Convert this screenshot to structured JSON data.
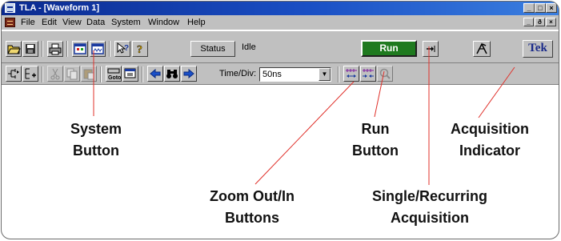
{
  "window": {
    "title": "TLA - [Waveform 1]",
    "minimize_glyph": "_",
    "maximize_glyph": "□",
    "close_glyph": "×",
    "restore_glyph": "ð",
    "doc_close_glyph": "×"
  },
  "menu": {
    "items": [
      {
        "label": "File"
      },
      {
        "label": "Edit"
      },
      {
        "label": "View"
      },
      {
        "label": "Data"
      },
      {
        "label": "System"
      },
      {
        "label": "Window"
      },
      {
        "label": "Help"
      }
    ]
  },
  "toolbar1": {
    "status_label": "Status",
    "status_text": "Idle",
    "run_label": "Run",
    "run_color": "#1f7a1f",
    "tek_label": "Tek",
    "icons": [
      "open-folder-icon",
      "save-icon",
      "print-icon",
      "system-window-icon",
      "new-window-icon",
      "context-help-icon",
      "help-icon",
      "single-recurring-arrow-icon",
      "acquisition-indicator-icon"
    ]
  },
  "toolbar2": {
    "timediv_label": "Time/Div:",
    "timediv_value": "50ns",
    "icons": [
      "add-waveform-icon",
      "add-group-icon",
      "cut-icon",
      "copy-icon",
      "paste-icon",
      "goto-icon",
      "properties-icon",
      "search-back-icon",
      "binoculars-icon",
      "search-forward-icon",
      "zoom-out-icon",
      "zoom-in-icon",
      "magnifier-icon"
    ]
  },
  "callouts": {
    "system_button": [
      "System",
      "Button"
    ],
    "run_button": [
      "Run",
      "Button"
    ],
    "acquisition_indicator": [
      "Acquisition",
      "Indicator"
    ],
    "zoom_buttons": [
      "Zoom Out/In",
      "Buttons"
    ],
    "single_recurring": [
      "Single/Recurring",
      "Acquisition"
    ]
  },
  "colors": {
    "titlebar_start": "#0b2a8f",
    "titlebar_end": "#3b7fe0",
    "chrome": "#c0c0c0",
    "leader_line": "#e0302a"
  }
}
